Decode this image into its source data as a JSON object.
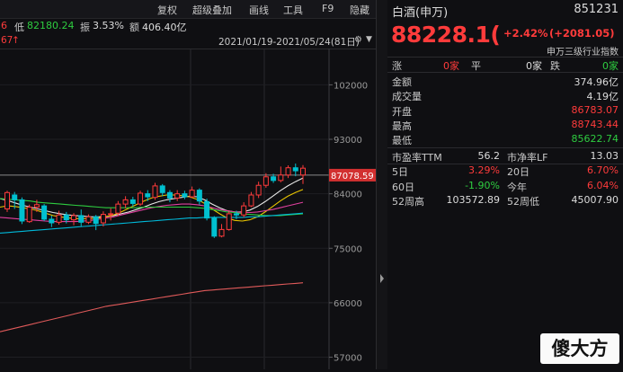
{
  "toolbar": {
    "items": [
      "复权",
      "超级叠加",
      "画线",
      "工具",
      "F9",
      "隐藏"
    ]
  },
  "info": {
    "prefix": "6",
    "low_label": "低",
    "low_value": "82180.24",
    "amp_label": "振",
    "amp_value": "3.53%",
    "amount_label": "额",
    "amount_value": "406.40亿"
  },
  "range": {
    "prefix": "67",
    "text": "2021/01/19-2021/05/24(81日)"
  },
  "price_axis": {
    "ticks": [
      "102000",
      "93000",
      "84000",
      "75000",
      "66000",
      "57000"
    ],
    "current_price": "87078.59"
  },
  "chart_data": {
    "type": "candlestick",
    "yaxis_ticks": [
      102000,
      93000,
      84000,
      75000,
      66000,
      57000
    ],
    "ylim": [
      55000,
      108000
    ],
    "current_price": 87078.59,
    "period": "2021/01/19-2021/05/24",
    "candles": [
      [
        81500,
        84200,
        81000,
        84500
      ],
      [
        83800,
        83000,
        81500,
        84300
      ],
      [
        83000,
        79500,
        79000,
        83400
      ],
      [
        79400,
        81800,
        79200,
        82200
      ],
      [
        81800,
        82200,
        81000,
        83000
      ],
      [
        82000,
        79800,
        79500,
        82300
      ],
      [
        79800,
        79200,
        78500,
        80400
      ],
      [
        79300,
        80500,
        78900,
        81200
      ],
      [
        80500,
        79700,
        79100,
        81000
      ],
      [
        79700,
        80400,
        78800,
        80800
      ],
      [
        80400,
        79300,
        78600,
        81400
      ],
      [
        79300,
        80200,
        79000,
        80600
      ],
      [
        80200,
        79100,
        78000,
        80500
      ],
      [
        79200,
        80600,
        78600,
        81100
      ],
      [
        80600,
        80700,
        79600,
        81600
      ],
      [
        80800,
        82300,
        80300,
        82800
      ],
      [
        82300,
        83000,
        81600,
        83600
      ],
      [
        83000,
        82400,
        81900,
        83500
      ],
      [
        82300,
        84100,
        82000,
        84500
      ],
      [
        84000,
        83500,
        82800,
        84600
      ],
      [
        83400,
        85300,
        83000,
        85800
      ],
      [
        85300,
        84200,
        83600,
        85600
      ],
      [
        84200,
        83300,
        82600,
        84600
      ],
      [
        83300,
        84000,
        82800,
        84600
      ],
      [
        84000,
        83500,
        83100,
        84500
      ],
      [
        83500,
        84600,
        83300,
        85200
      ],
      [
        84600,
        82800,
        82200,
        84900
      ],
      [
        82700,
        80000,
        79600,
        83200
      ],
      [
        80000,
        77000,
        76700,
        80300
      ],
      [
        77000,
        78100,
        76800,
        79000
      ],
      [
        78100,
        80700,
        77900,
        81100
      ],
      [
        80700,
        80500,
        79800,
        81200
      ],
      [
        80500,
        82000,
        80100,
        82600
      ],
      [
        82000,
        83800,
        81800,
        84300
      ],
      [
        83800,
        85400,
        83300,
        86000
      ],
      [
        85400,
        86800,
        85000,
        87400
      ],
      [
        86800,
        86200,
        85800,
        87300
      ],
      [
        86200,
        87100,
        85900,
        88500
      ],
      [
        87100,
        88300,
        86600,
        88700
      ],
      [
        88300,
        87800,
        86900,
        89000
      ],
      [
        87100,
        88228,
        85622,
        88743
      ]
    ],
    "ma_series": [
      {
        "color": "#e8e8e8",
        "values": [
          83200,
          82900,
          82500,
          82100,
          81800,
          81500,
          81200,
          80900,
          80700,
          80500,
          80400,
          80300,
          80200,
          80200,
          80250,
          80400,
          80700,
          81000,
          81400,
          81800,
          82300,
          82700,
          83000,
          83200,
          83400,
          83600,
          83500,
          83000,
          82300,
          81700,
          81200,
          81000,
          81000,
          81300,
          81900,
          82700,
          83600,
          84500,
          85300,
          86000,
          86600
        ]
      },
      {
        "color": "#e8c400",
        "values": [
          81800,
          82000,
          81900,
          81700,
          81500,
          81200,
          80800,
          80400,
          80200,
          80000,
          79900,
          79900,
          79900,
          80000,
          80200,
          80500,
          81000,
          81600,
          82200,
          82800,
          83300,
          83600,
          83800,
          83800,
          83700,
          83500,
          83100,
          82400,
          81500,
          80700,
          80000,
          79600,
          79500,
          79700,
          80200,
          81000,
          81900,
          82800,
          83600,
          84200,
          84700
        ]
      },
      {
        "color": "#e0409f",
        "values": [
          80100,
          80000,
          79900,
          79800,
          79700,
          79600,
          79500,
          79400,
          79400,
          79400,
          79400,
          79500,
          79600,
          79800,
          80000,
          80200,
          80500,
          80800,
          81100,
          81400,
          81700,
          81900,
          82100,
          82200,
          82300,
          82300,
          82200,
          82000,
          81700,
          81400,
          81200,
          81000,
          80900,
          80900,
          81000,
          81200,
          81400,
          81700,
          82000,
          82300,
          82600
        ]
      },
      {
        "color": "#2ecc40",
        "values": [
          83200,
          83100,
          83000,
          82900,
          82800,
          82600,
          82500,
          82400,
          82300,
          82200,
          82100,
          82000,
          81900,
          81800,
          81700,
          81700,
          81700,
          81700,
          81700,
          81800,
          81800,
          81800,
          81800,
          81800,
          81800,
          81800,
          81700,
          81600,
          81400,
          81200,
          81000,
          80900,
          80700,
          80600,
          80500,
          80400,
          80400,
          80400,
          80500,
          80600,
          80700
        ]
      },
      {
        "color": "#00b8d8",
        "values": [
          77500,
          77600,
          77700,
          77800,
          77900,
          78000,
          78100,
          78200,
          78300,
          78400,
          78500,
          78600,
          78700,
          78800,
          78900,
          79000,
          79100,
          79200,
          79300,
          79400,
          79500,
          79600,
          79700,
          79800,
          79900,
          80000,
          80000,
          80100,
          80100,
          80100,
          80100,
          80100,
          80100,
          80200,
          80200,
          80300,
          80400,
          80500,
          80600,
          80700,
          80800
        ]
      },
      {
        "color": "#e05a5a",
        "values": [
          61200,
          61500,
          61800,
          62100,
          62400,
          62700,
          63000,
          63300,
          63600,
          63900,
          64200,
          64500,
          64800,
          65100,
          65400,
          65600,
          65800,
          66000,
          66200,
          66400,
          66600,
          66800,
          67000,
          67200,
          67400,
          67600,
          67800,
          68000,
          68100,
          68200,
          68300,
          68400,
          68500,
          68600,
          68700,
          68800,
          68900,
          69000,
          69100,
          69200,
          69300
        ]
      }
    ]
  },
  "panel": {
    "name": "白酒(申万)",
    "code": "851231",
    "price": "88228.1(",
    "pct_change": "+2.42%",
    "abs_change": "(+2081.05)",
    "category": "申万三级行业指数",
    "breadth": {
      "up_label": "涨",
      "up_value": "0家",
      "flat_label": "平",
      "flat_value": "0家",
      "down_label": "跌",
      "down_value": "0家"
    },
    "stats": [
      {
        "label": "金额",
        "value": "374.96亿",
        "color": "white"
      },
      {
        "label": "成交量",
        "value": "4.19亿",
        "color": "white"
      },
      {
        "label": "开盘",
        "value": "86783.07",
        "color": "red"
      },
      {
        "label": "最高",
        "value": "88743.44",
        "color": "red"
      },
      {
        "label": "最低",
        "value": "85622.74",
        "color": "green"
      }
    ],
    "grid": [
      {
        "l1": "市盈率TTM",
        "v1": "56.2",
        "c1": "white",
        "l2": "市净率LF",
        "v2": "13.03",
        "c2": "white"
      },
      {
        "l1": "5日",
        "v1": "3.29%",
        "c1": "red",
        "l2": "20日",
        "v2": "6.70%",
        "c2": "red"
      },
      {
        "l1": "60日",
        "v1": "-1.90%",
        "c1": "green",
        "l2": "今年",
        "v2": "6.04%",
        "c2": "red"
      },
      {
        "l1": "52周高",
        "v1": "103572.89",
        "c1": "white",
        "l2": "52周低",
        "v2": "45007.90",
        "c2": "white"
      }
    ]
  },
  "watermark": "傻大方",
  "colors": {
    "up": "#ff3b3b",
    "down": "#2ecc40",
    "candle_down": "#00c0d0",
    "background": "#0f0f12"
  }
}
